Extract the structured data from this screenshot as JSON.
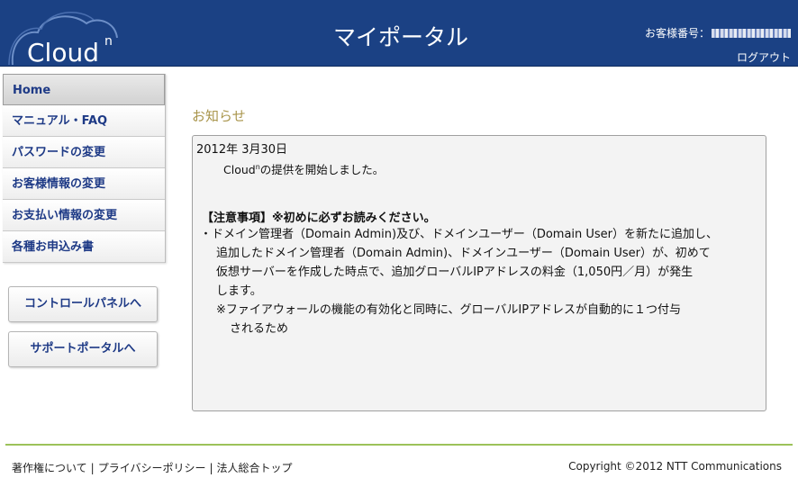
{
  "header": {
    "logo_text": "Cloud",
    "logo_sup": "n",
    "title": "マイポータル",
    "customer_label": "お客様番号：",
    "logout": "ログアウト"
  },
  "sidebar": {
    "items": [
      {
        "label": "Home"
      },
      {
        "label": "マニュアル・FAQ"
      },
      {
        "label": "パスワードの変更"
      },
      {
        "label": "お客様情報の変更"
      },
      {
        "label": "お支払い情報の変更"
      },
      {
        "label": "各種お申込み書"
      }
    ],
    "buttons": {
      "control_panel": "コントロールパネルへ",
      "support_portal": "サポートポータルへ"
    }
  },
  "notice": {
    "heading": "お知らせ",
    "date": "2012年 3月30日",
    "msg_pre": "Cloud",
    "msg_sup": "n",
    "msg_post": "の提供を開始しました。",
    "caution": "【注意事項】※初めに必ずお読みください。",
    "lines": [
      "・ドメイン管理者（Domain Admin)及び、ドメインユーザー（Domain User）を新たに追加し、",
      "追加したドメイン管理者（Domain Admin)、ドメインユーザー（Domain User）が、初めて",
      "仮想サーバーを作成した時点で、追加グローバルIPアドレスの料金（1,050円／月）が発生",
      "します。",
      "※ファイアウォールの機能の有効化と同時に、グローバルIPアドレスが自動的に１つ付与",
      "されるため"
    ]
  },
  "footer": {
    "links": [
      "著作権について",
      "プライバシーポリシー",
      "法人総合トップ"
    ],
    "separator": "|",
    "copyright": "Copyright ©2012 NTT Communications"
  }
}
